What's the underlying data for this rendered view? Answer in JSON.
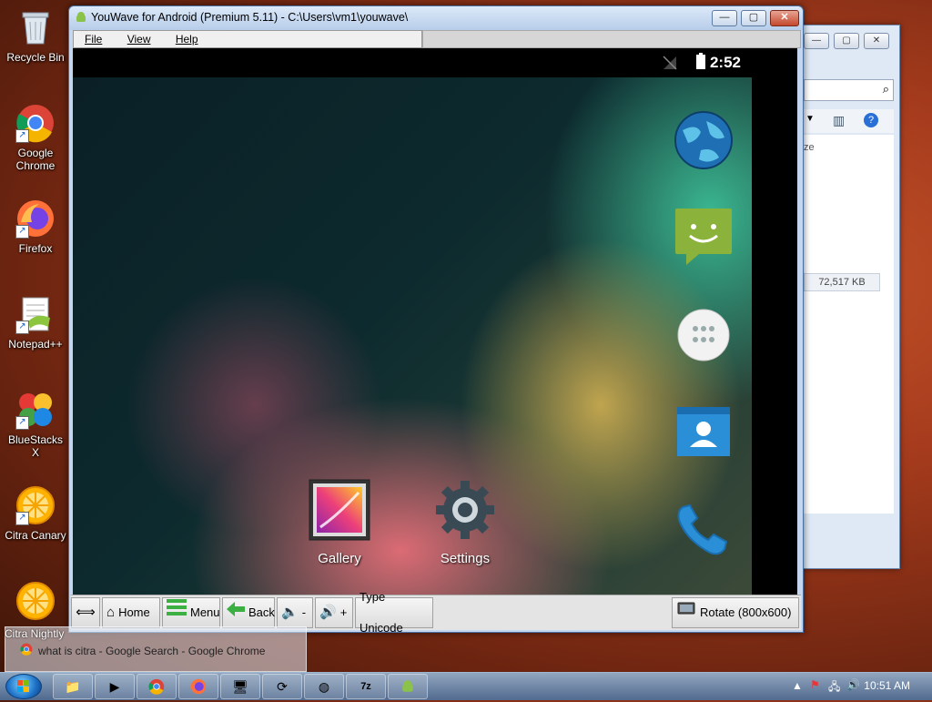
{
  "desktop": {
    "icons": [
      {
        "label": "Recycle Bin",
        "icon": "recycle-bin-icon"
      },
      {
        "label": "Google Chrome",
        "icon": "chrome-icon"
      },
      {
        "label": "Firefox",
        "icon": "firefox-icon"
      },
      {
        "label": "Notepad++",
        "icon": "notepad-plus-plus-icon"
      },
      {
        "label": "BlueStacks X",
        "icon": "bluestacks-icon"
      },
      {
        "label": "Citra Canary",
        "icon": "citra-icon"
      }
    ]
  },
  "explorer_back": {
    "size_column": "ze",
    "size_value": "72,517 KB"
  },
  "window": {
    "title": "YouWave for Android (Premium 5.11) - C:\\Users\\vm1\\youwave\\",
    "menu": {
      "file": "File",
      "view": "View",
      "help": "Help"
    },
    "controls": {
      "minimize": "—",
      "maximize": "▢",
      "close": "✕"
    }
  },
  "android": {
    "clock": "2:52",
    "apps": [
      {
        "label": "Gallery",
        "icon": "gallery-icon"
      },
      {
        "label": "Settings",
        "icon": "settings-icon"
      }
    ],
    "dock": [
      "browser-globe-icon",
      "messaging-icon",
      "app-drawer-icon",
      "contacts-icon",
      "phone-icon"
    ]
  },
  "toolbar": {
    "resize_glyph": "⟺",
    "home": "Home",
    "menu": "Menu",
    "back": "Back",
    "vol_down": "-",
    "vol_up": "+",
    "type_unicode": "Type Unicode",
    "rotate": "Rotate (800x600)"
  },
  "taskbar": {
    "preview_title": "Citra Nightly",
    "preview_item": "what is citra - Google Search - Google Chrome",
    "clock": "10:51 AM"
  },
  "colors": {
    "titlebar": "#c5d7ee",
    "close": "#c4472c",
    "taskbar": "#6d8fb4"
  }
}
